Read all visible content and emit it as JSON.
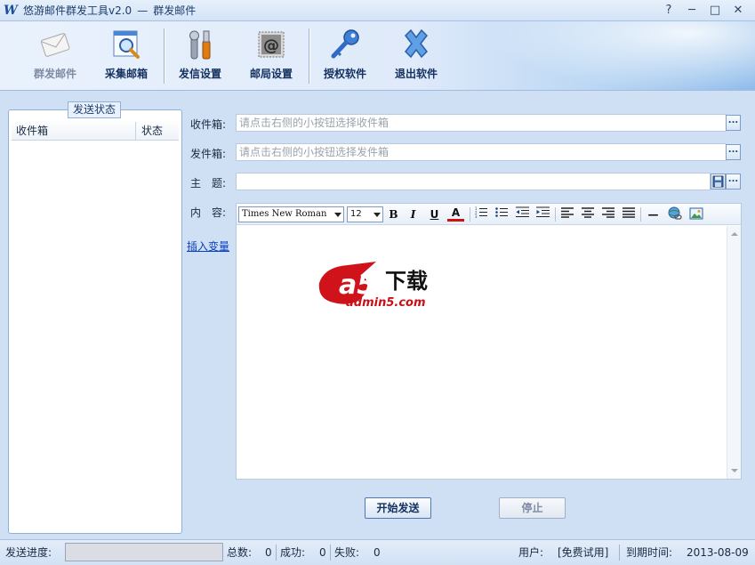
{
  "window": {
    "title": "悠游邮件群发工具v2.0",
    "title_sep": "—",
    "subtitle": "群发邮件",
    "help": "?",
    "minimize": "─",
    "maximize": "□",
    "close": "✕"
  },
  "toolbar": {
    "mass_send": "群发邮件",
    "collect": "采集邮箱",
    "send_settings": "发信设置",
    "mail_settings": "邮局设置",
    "license": "授权软件",
    "exit": "退出软件"
  },
  "status_panel": {
    "title": "发送状态",
    "col_recipient": "收件箱",
    "col_status": "状态"
  },
  "form": {
    "to_label": "收件箱:",
    "to_placeholder": "请点击右侧的小按钮选择收件箱",
    "from_label": "发件箱:",
    "from_placeholder": "请点击右侧的小按钮选择发件箱",
    "subject_label": "主　题:",
    "subject_value": "",
    "content_label": "内　容:",
    "insert_var": "插入变量",
    "pick_button": "..."
  },
  "editor": {
    "font": "Times New Roman",
    "size": "12",
    "bold": "B",
    "italic": "I",
    "underline": "U",
    "color": "A",
    "hr": "—"
  },
  "watermark": {
    "brand_mark": "a5",
    "brand_text": "下载",
    "domain": "admin5.com"
  },
  "actions": {
    "start": "开始发送",
    "stop": "停止"
  },
  "statusbar": {
    "progress_label": "发送进度:",
    "total_label": "总数:",
    "total": "0",
    "success_label": "成功:",
    "success": "0",
    "fail_label": "失败:",
    "fail": "0",
    "user_label": "用户:",
    "user_value": "[免费试用]",
    "expire_label": "到期时间:",
    "expire_value": "2013-08-09"
  }
}
